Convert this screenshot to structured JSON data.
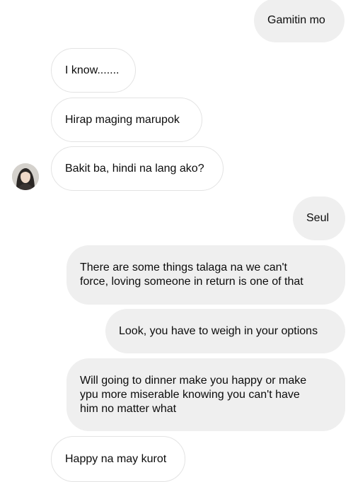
{
  "conversation": {
    "messages": [
      {
        "id": "m1",
        "side": "sent",
        "text": "Gamitin mo"
      },
      {
        "id": "m2",
        "side": "received",
        "text": "I know......."
      },
      {
        "id": "m3",
        "side": "received",
        "text": "Hirap maging marupok"
      },
      {
        "id": "m4",
        "side": "received",
        "text": "Bakit ba, hindi na lang ako?"
      },
      {
        "id": "m5",
        "side": "sent",
        "text": "Seul"
      },
      {
        "id": "m6",
        "side": "sent",
        "text": "There are some things talaga na we can't\nforce, loving someone in return is one of that"
      },
      {
        "id": "m7",
        "side": "sent",
        "text": "Look, you have to weigh in your options"
      },
      {
        "id": "m8",
        "side": "sent",
        "text": "Will going to dinner make you happy or make\nypu more miserable knowing you can't have\nhim no matter what"
      },
      {
        "id": "m9",
        "side": "received",
        "text": "Happy na may kurot"
      }
    ]
  },
  "colors": {
    "sent_bubble": "#efefef",
    "received_bubble": "#ffffff",
    "received_border": "#e3e3e3",
    "text": "#0c0c0c"
  },
  "icons": {
    "avatar": "contact-avatar-photo"
  }
}
